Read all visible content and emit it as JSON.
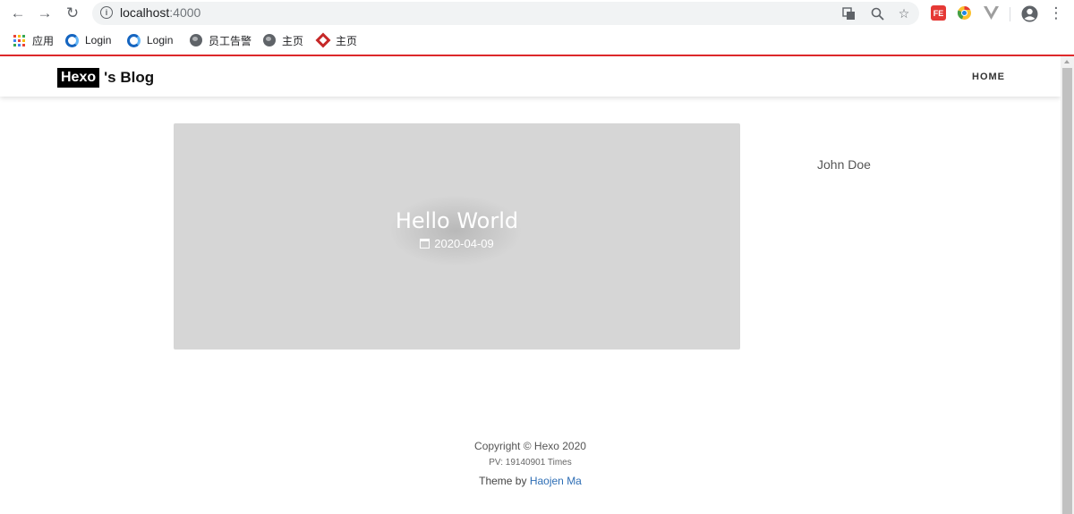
{
  "browser": {
    "url_host": "localhost",
    "url_port": ":4000",
    "bookmarks": [
      {
        "label": "应用",
        "icon": "apps-grid-icon"
      },
      {
        "label": "Login",
        "icon": "swirl-logo-icon"
      },
      {
        "label": "Login",
        "icon": "swirl-logo-icon"
      },
      {
        "label": "员工告警",
        "icon": "globe-icon"
      },
      {
        "label": "主页",
        "icon": "globe-icon"
      },
      {
        "label": "主页",
        "icon": "diamond-logo-icon"
      }
    ],
    "extensions": [
      {
        "label": "FE",
        "color": "#e53935"
      },
      {
        "label": "",
        "color": "#fbc02d"
      },
      {
        "label": "",
        "color": "#9e9e9e"
      }
    ]
  },
  "site": {
    "brand_box": "Hexo",
    "brand_rest": "'s Blog",
    "nav_home": "HOME",
    "accent_color": "#e0292b"
  },
  "post": {
    "title": "Hello World",
    "date": "2020-04-09"
  },
  "sidebar": {
    "author": "John Doe"
  },
  "footer": {
    "copyright": "Copyright © Hexo 2020",
    "pv": "PV: 19140901 Times",
    "theme_prefix": "Theme by ",
    "theme_author": "Haojen Ma"
  }
}
